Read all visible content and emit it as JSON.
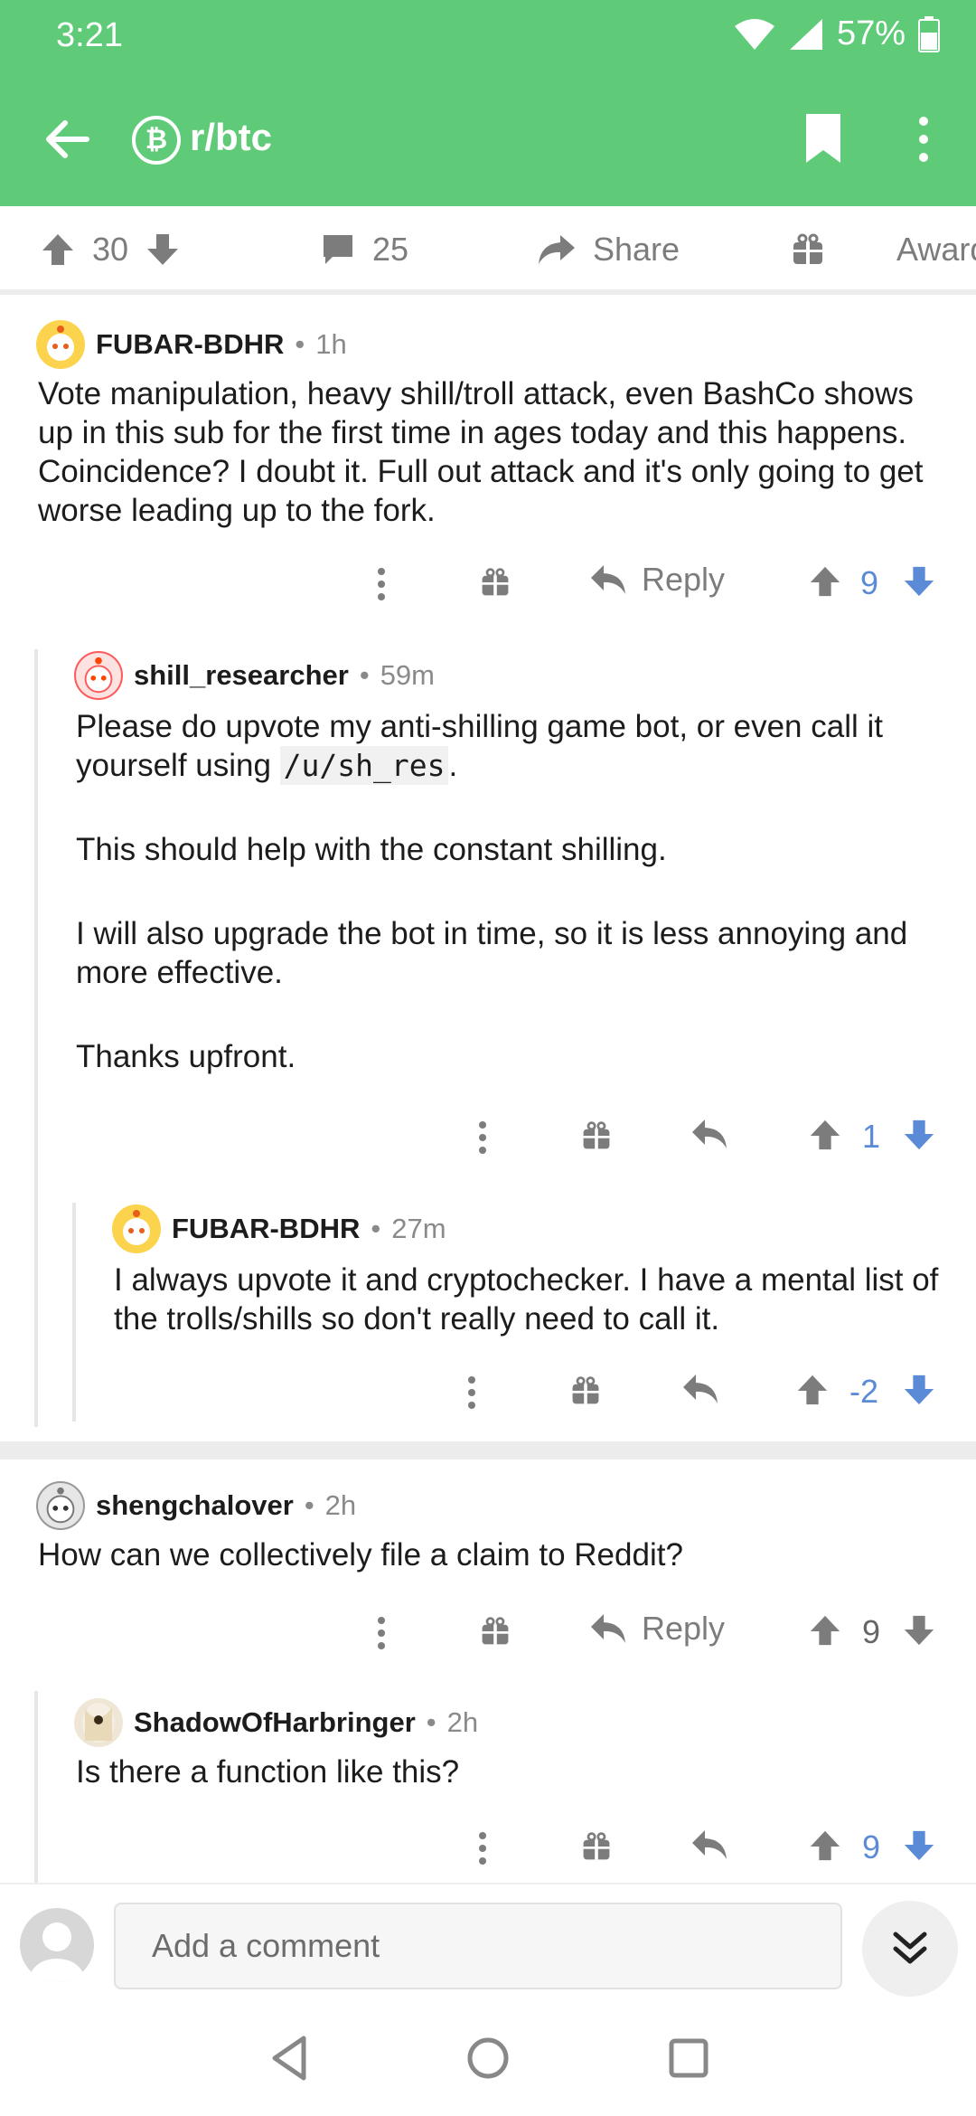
{
  "status": {
    "time": "3:21",
    "battery": "57%"
  },
  "appbar": {
    "subreddit": "r/btc",
    "sub_icon_glyph": "₿"
  },
  "post_actions": {
    "upvotes": "30",
    "comments": "25",
    "share_label": "Share",
    "award_label": "Award"
  },
  "comments": [
    {
      "user": "FUBAR-BDHR",
      "age": "1h",
      "paragraphs": [
        "Vote manipulation, heavy shill/troll attack, even BashCo shows up in this sub for the first time in ages today and this happens.  Coincidence?  I doubt it.  Full out attack and it's only going to get worse leading up to the fork."
      ],
      "reply_label": "Reply",
      "score": "9",
      "vote": "up"
    },
    {
      "user": "shill_researcher",
      "age": "59m",
      "para1_before": "Please do upvote my anti-shilling game bot, or even call it yourself using ",
      "para1_code": "/u/sh_res",
      "para1_after": ".",
      "para2": "This should help with the constant shilling.",
      "para3": "I will also upgrade the bot in time, so it is less annoying and more effective.",
      "para4": "Thanks upfront.",
      "score": "1",
      "vote": "up"
    },
    {
      "user": "FUBAR-BDHR",
      "age": "27m",
      "paragraphs": [
        "I always upvote it and cryptochecker. I have a mental list of the trolls/shills so don't really need to call it."
      ],
      "score": "-2",
      "vote": "up"
    },
    {
      "user": "shengchalover",
      "age": "2h",
      "paragraphs": [
        "How can we collectively file a claim to Reddit?"
      ],
      "reply_label": "Reply",
      "score": "9",
      "vote": "none"
    },
    {
      "user": "ShadowOfHarbringer",
      "age": "2h",
      "paragraphs": [
        "Is there a function like this?"
      ],
      "score": "9",
      "vote": "up"
    }
  ],
  "composer": {
    "placeholder": "Add a comment"
  },
  "colors": {
    "header": "#5fcb78",
    "vote_blue": "#5b8bd6",
    "meta_grey": "#8a8a8a"
  }
}
